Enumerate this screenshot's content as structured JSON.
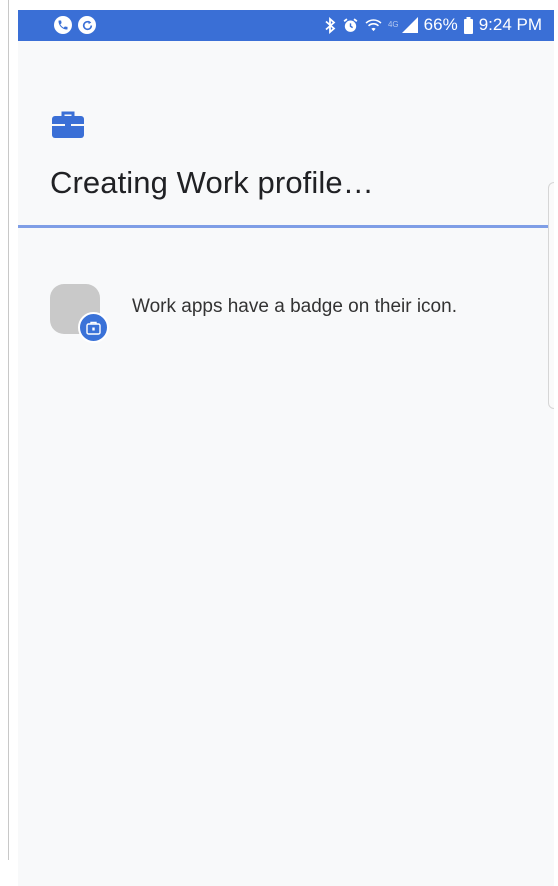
{
  "status_bar": {
    "left_icons": [
      "phone-call-icon",
      "sync-icon"
    ],
    "right_icons": [
      "bluetooth-icon",
      "alarm-icon",
      "wifi-icon",
      "signal-icon",
      "battery-icon"
    ],
    "network_label": "4G",
    "battery_percent": "66%",
    "time": "9:24 PM",
    "color": "#3a6fd6"
  },
  "header": {
    "icon": "briefcase-icon",
    "title": "Creating Work profile…"
  },
  "progress": {
    "style": "indeterminate",
    "track_color": "#c6d3f3",
    "fill_color": "#7f9ee6"
  },
  "info": {
    "icon": "app-icon-with-work-badge",
    "badge_icon": "briefcase-badge-icon",
    "text": "Work apps have a badge on their icon.",
    "accent": "#3a72d8"
  }
}
